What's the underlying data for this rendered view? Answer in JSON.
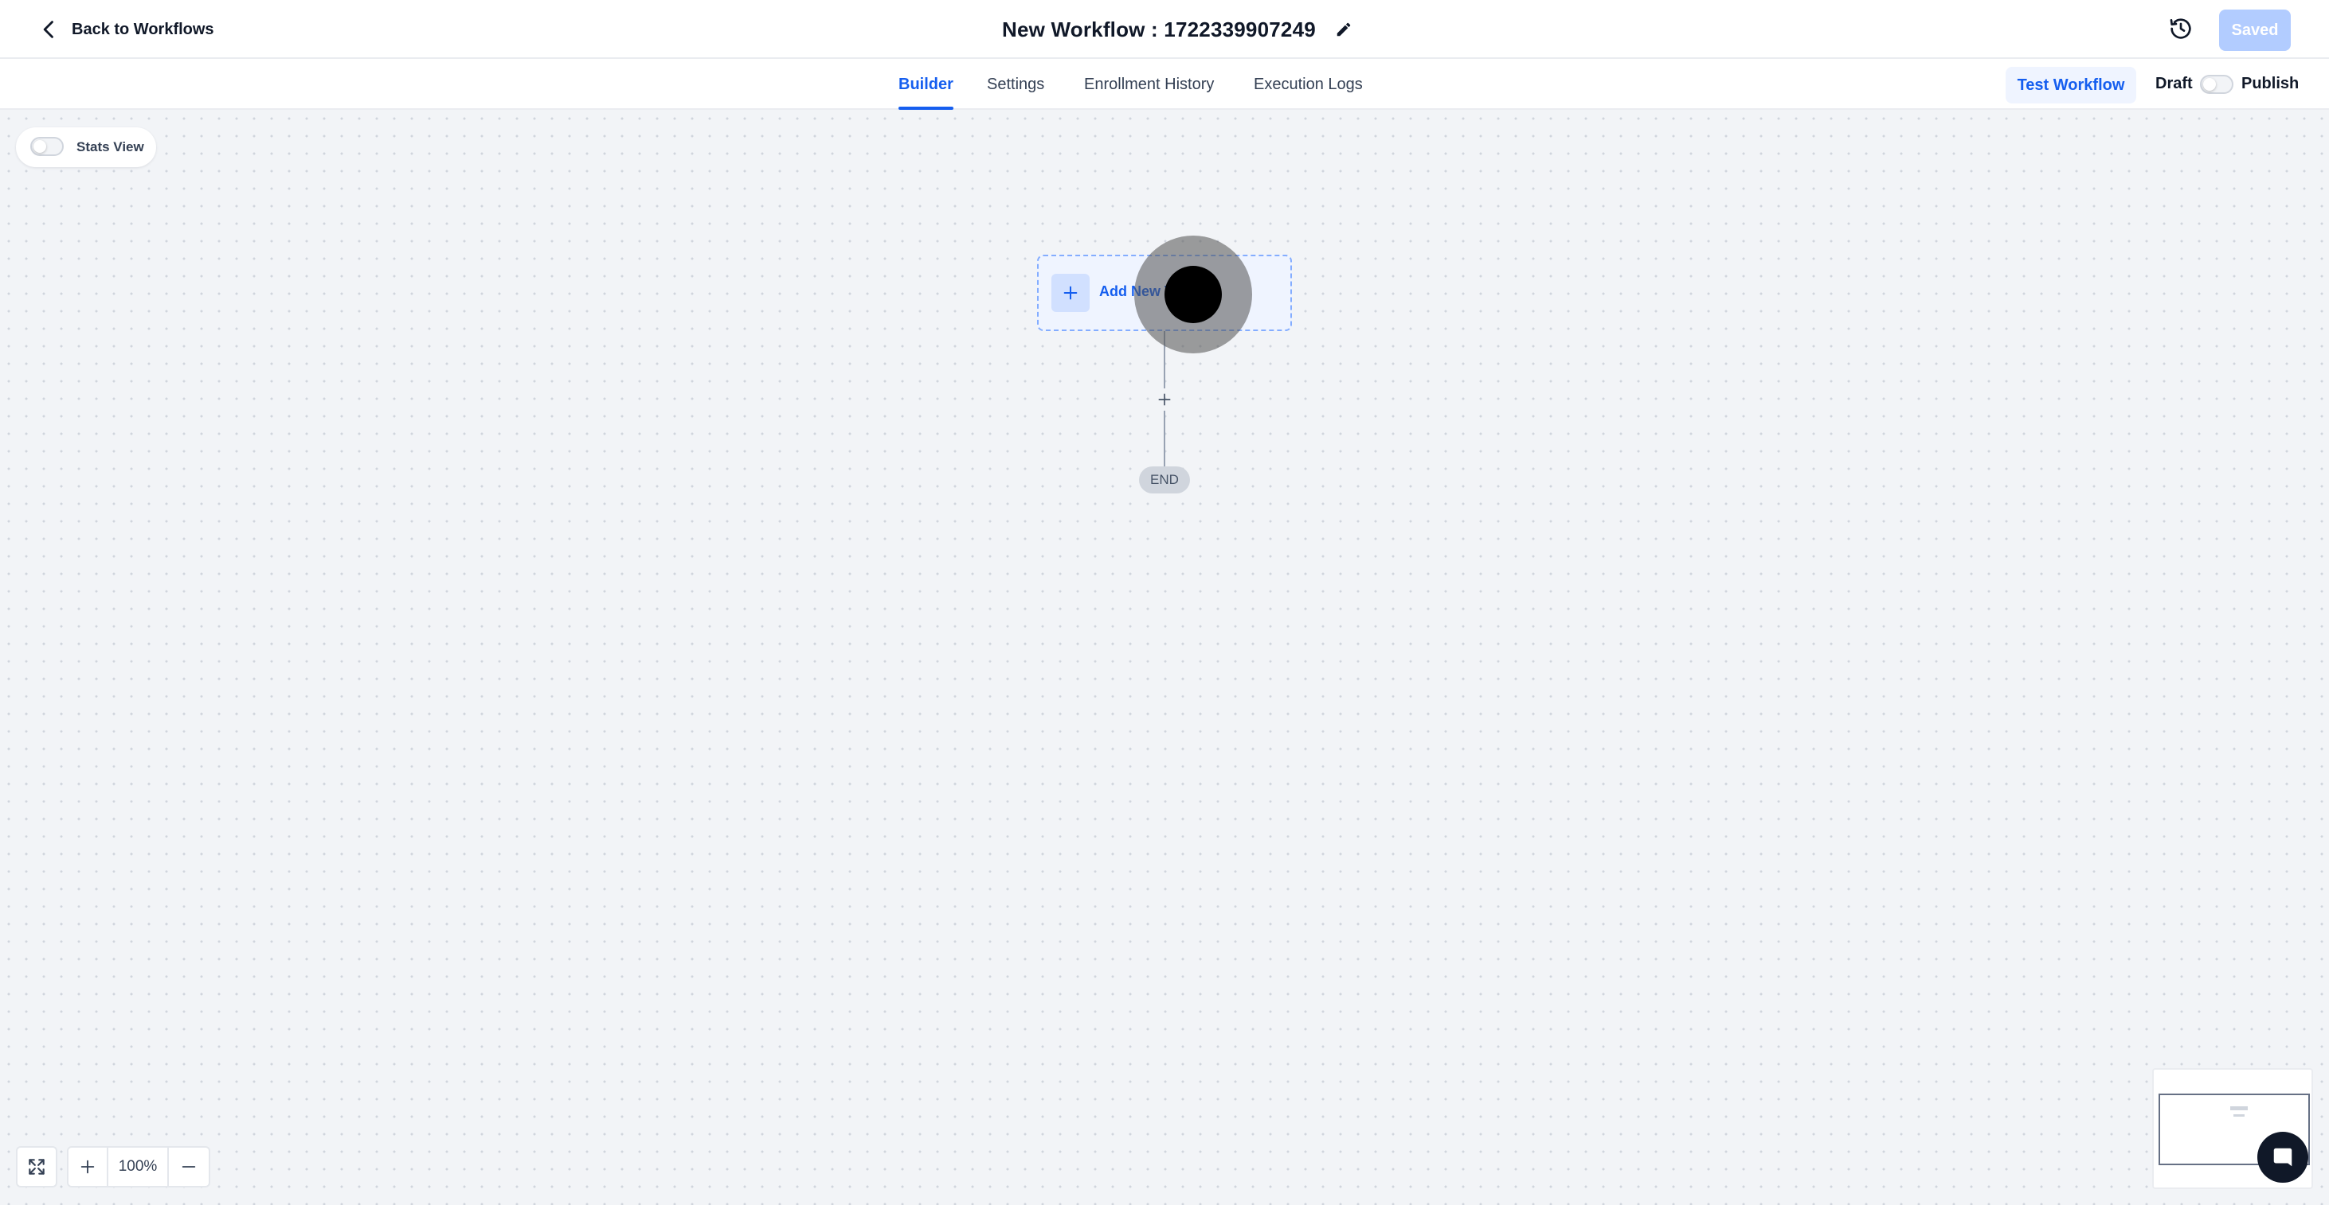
{
  "header": {
    "back_label": "Back to Workflows",
    "title": "New Workflow : 1722339907249",
    "saved_label": "Saved",
    "icons": {
      "back": "chevron-left-icon",
      "edit": "pencil-icon",
      "history": "history-icon"
    }
  },
  "tabs": [
    {
      "label": "Builder",
      "active": true
    },
    {
      "label": "Settings",
      "active": false
    },
    {
      "label": "Enrollment History",
      "active": false
    },
    {
      "label": "Execution Logs",
      "active": false
    }
  ],
  "actions": {
    "test_label": "Test Workflow",
    "draft_label": "Draft",
    "publish_label": "Publish",
    "publish_enabled": false
  },
  "canvas": {
    "stats_view_label": "Stats View",
    "stats_view_enabled": false,
    "trigger_label": "Add New Trigger",
    "end_label": "END",
    "zoom": "100%"
  },
  "colors": {
    "accent": "#155eef",
    "accent_light": "#eff4ff",
    "saved_disabled": "#b2ccff",
    "canvas_bg": "#f2f4f7"
  }
}
